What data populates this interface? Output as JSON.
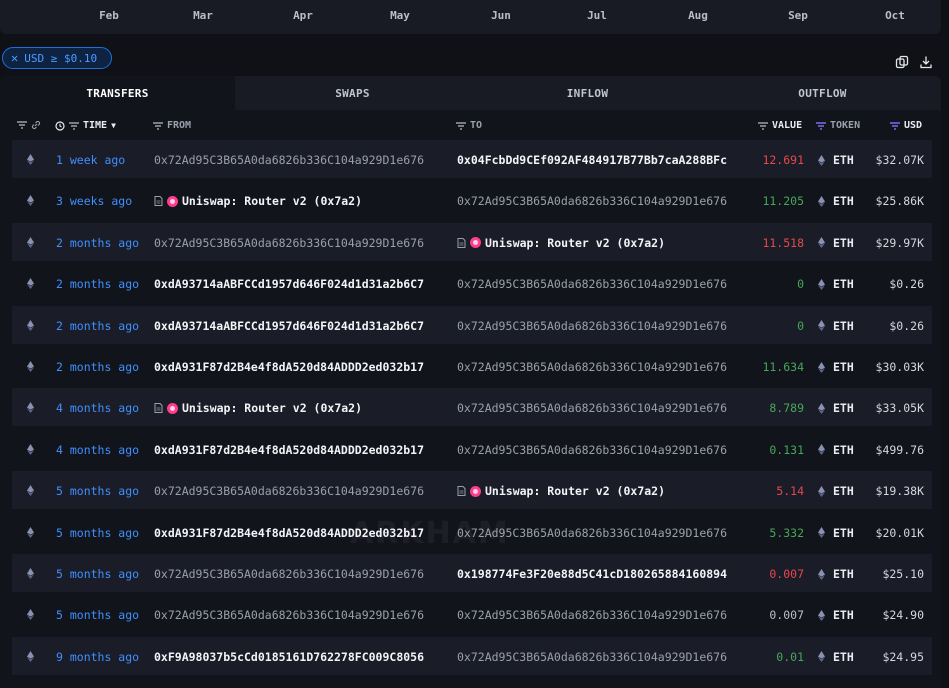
{
  "axis": {
    "months": [
      "Feb",
      "Mar",
      "Apr",
      "May",
      "Jun",
      "Jul",
      "Aug",
      "Sep",
      "Oct"
    ]
  },
  "filter": {
    "chip_label": "USD ≥ $0.10"
  },
  "tabs": [
    {
      "label": "TRANSFERS",
      "active": true
    },
    {
      "label": "SWAPS",
      "active": false
    },
    {
      "label": "INFLOW",
      "active": false
    },
    {
      "label": "OUTFLOW",
      "active": false
    }
  ],
  "columns": {
    "time": "TIME",
    "from": "FROM",
    "to": "TO",
    "value": "VALUE",
    "token": "TOKEN",
    "usd": "USD"
  },
  "watermark": "ARKHAM",
  "colors": {
    "accent": "#3f8fff",
    "negative": "#e5484d",
    "positive": "#46a758",
    "uniswap": "#ff3c8e"
  },
  "rows": [
    {
      "time": "1 week ago",
      "from": "0x72Ad95C3B65A0da6826b336C104a929D1e676",
      "from_type": "addr",
      "to": "0x04FcbDd9CEf092AF484917B77Bb7caA288BFc",
      "to_type": "addr-bright",
      "value": "12.691",
      "value_type": "red",
      "token": "ETH",
      "usd": "$32.07K"
    },
    {
      "time": "3 weeks ago",
      "from": "Uniswap: Router v2 (0x7a2)",
      "from_type": "entity",
      "to": "0x72Ad95C3B65A0da6826b336C104a929D1e676",
      "to_type": "addr",
      "value": "11.205",
      "value_type": "green",
      "token": "ETH",
      "usd": "$25.86K"
    },
    {
      "time": "2 months ago",
      "from": "0x72Ad95C3B65A0da6826b336C104a929D1e676",
      "from_type": "addr",
      "to": "Uniswap: Router v2 (0x7a2)",
      "to_type": "entity",
      "value": "11.518",
      "value_type": "red",
      "token": "ETH",
      "usd": "$29.97K"
    },
    {
      "time": "2 months ago",
      "from": "0xdA93714aABFCCd1957d646F024d1d31a2b6C7",
      "from_type": "addr-bright",
      "to": "0x72Ad95C3B65A0da6826b336C104a929D1e676",
      "to_type": "addr",
      "value": "0",
      "value_type": "green",
      "token": "ETH",
      "usd": "$0.26"
    },
    {
      "time": "2 months ago",
      "from": "0xdA93714aABFCCd1957d646F024d1d31a2b6C7",
      "from_type": "addr-bright",
      "to": "0x72Ad95C3B65A0da6826b336C104a929D1e676",
      "to_type": "addr",
      "value": "0",
      "value_type": "green",
      "token": "ETH",
      "usd": "$0.26"
    },
    {
      "time": "2 months ago",
      "from": "0xdA931F87d2B4e4f8dA520d84ADDD2ed032b17",
      "from_type": "addr-bright",
      "to": "0x72Ad95C3B65A0da6826b336C104a929D1e676",
      "to_type": "addr",
      "value": "11.634",
      "value_type": "green",
      "token": "ETH",
      "usd": "$30.03K"
    },
    {
      "time": "4 months ago",
      "from": "Uniswap: Router v2 (0x7a2)",
      "from_type": "entity",
      "to": "0x72Ad95C3B65A0da6826b336C104a929D1e676",
      "to_type": "addr",
      "value": "8.789",
      "value_type": "green",
      "token": "ETH",
      "usd": "$33.05K"
    },
    {
      "time": "4 months ago",
      "from": "0xdA931F87d2B4e4f8dA520d84ADDD2ed032b17",
      "from_type": "addr-bright",
      "to": "0x72Ad95C3B65A0da6826b336C104a929D1e676",
      "to_type": "addr",
      "value": "0.131",
      "value_type": "green",
      "token": "ETH",
      "usd": "$499.76"
    },
    {
      "time": "5 months ago",
      "from": "0x72Ad95C3B65A0da6826b336C104a929D1e676",
      "from_type": "addr",
      "to": "Uniswap: Router v2 (0x7a2)",
      "to_type": "entity",
      "value": "5.14",
      "value_type": "red",
      "token": "ETH",
      "usd": "$19.38K"
    },
    {
      "time": "5 months ago",
      "from": "0xdA931F87d2B4e4f8dA520d84ADDD2ed032b17",
      "from_type": "addr-bright",
      "to": "0x72Ad95C3B65A0da6826b336C104a929D1e676",
      "to_type": "addr",
      "value": "5.332",
      "value_type": "green",
      "token": "ETH",
      "usd": "$20.01K"
    },
    {
      "time": "5 months ago",
      "from": "0x72Ad95C3B65A0da6826b336C104a929D1e676",
      "from_type": "addr",
      "to": "0x198774Fe3F20e88d5C41cD180265884160894",
      "to_type": "addr-bright",
      "value": "0.007",
      "value_type": "red",
      "token": "ETH",
      "usd": "$25.10"
    },
    {
      "time": "5 months ago",
      "from": "0x72Ad95C3B65A0da6826b336C104a929D1e676",
      "from_type": "addr",
      "to": "0x72Ad95C3B65A0da6826b336C104a929D1e676",
      "to_type": "addr",
      "value": "0.007",
      "value_type": "white",
      "token": "ETH",
      "usd": "$24.90"
    },
    {
      "time": "9 months ago",
      "from": "0xF9A98037b5cCd0185161D762278FC009C8056",
      "from_type": "addr-bright",
      "to": "0x72Ad95C3B65A0da6826b336C104a929D1e676",
      "to_type": "addr",
      "value": "0.01",
      "value_type": "green",
      "token": "ETH",
      "usd": "$24.95"
    }
  ]
}
